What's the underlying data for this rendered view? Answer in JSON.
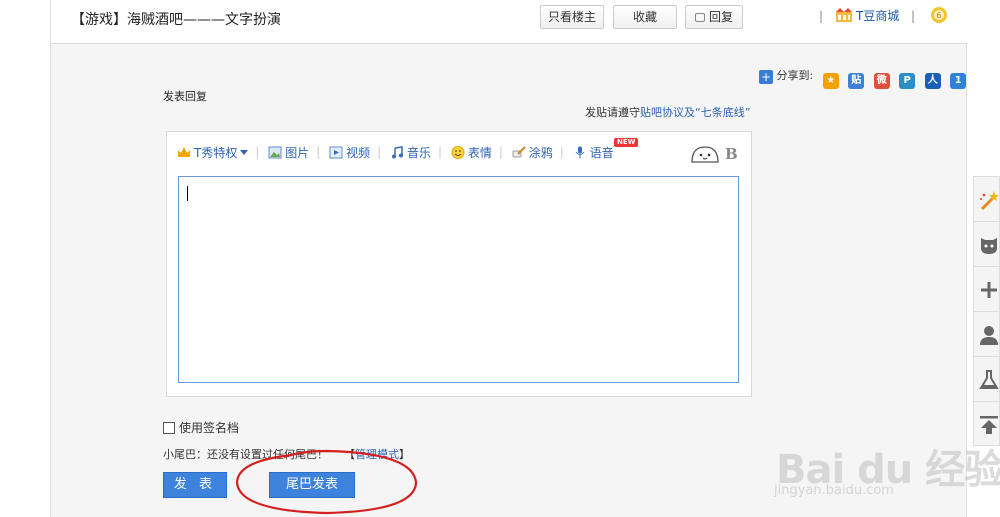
{
  "header": {
    "thread_title": "【游戏】海贼酒吧———文字扮演",
    "only_op_label": "只看楼主",
    "favorite_label": "收藏",
    "reply_label": "回复",
    "separator": "|",
    "tdou_mall_label": "T豆商城"
  },
  "share": {
    "label": "分享到:",
    "icons": [
      "qzone-icon",
      "tieba-icon",
      "weibo-icon",
      "pengyou-icon",
      "renren-icon",
      "qq-icon"
    ]
  },
  "reply_section": {
    "title": "发表回复",
    "rules_prefix": "发贴请遵守",
    "rules_link": "贴吧协议及“七条底线”"
  },
  "editor": {
    "tools": [
      {
        "label": "T秀特权"
      },
      {
        "label": "图片"
      },
      {
        "label": "视频"
      },
      {
        "label": "音乐"
      },
      {
        "label": "表情"
      },
      {
        "label": "涂鸦"
      },
      {
        "label": "语音"
      }
    ],
    "new_badge": "NEW",
    "bold_label": "B",
    "text_value": ""
  },
  "signature": {
    "label": "使用签名档",
    "checked": false
  },
  "tail": {
    "text": "小尾巴：还没有设置过任何尾巴！",
    "bracket_open": "【",
    "manage_link": "管理模式",
    "bracket_close": "】"
  },
  "actions": {
    "submit_label": "发 表",
    "tail_submit_label": "尾巴发表"
  },
  "watermark": {
    "main": "Bai du 经验",
    "sub": "jingyan.baidu.com"
  },
  "colors": {
    "primary_button": "#3d82dc",
    "link": "#2d64b3",
    "annotation": "#d41f1f"
  }
}
